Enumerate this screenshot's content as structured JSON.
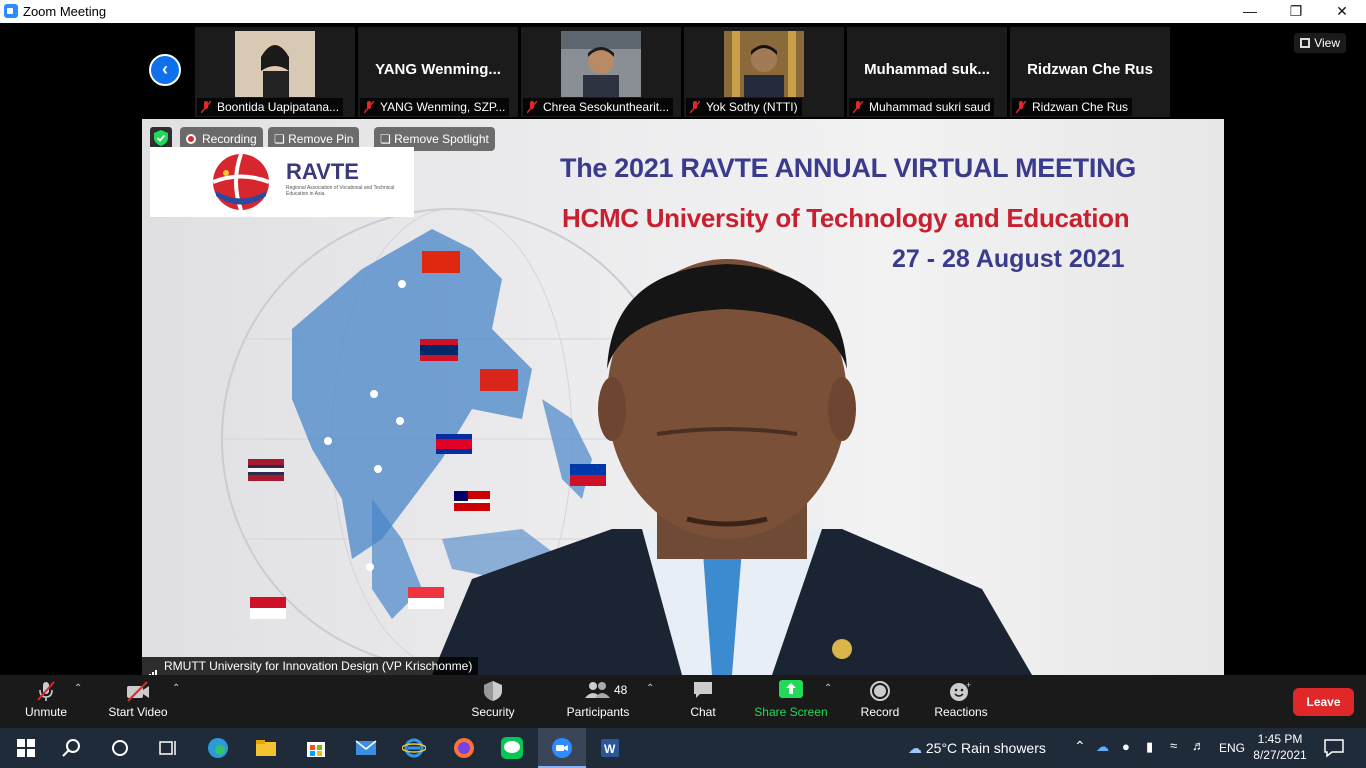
{
  "window": {
    "title": "Zoom Meeting"
  },
  "gallery": {
    "view_label": "View",
    "tiles": [
      {
        "label": "Boontida Uapipatana...",
        "name": ""
      },
      {
        "label": "YANG Wenming, SZP...",
        "name": "YANG  Wenming..."
      },
      {
        "label": "Chrea Sesokunthearit...",
        "name": ""
      },
      {
        "label": "Yok Sothy (NTTI)",
        "name": ""
      },
      {
        "label": "Muhammad sukri saud",
        "name": "Muhammad  suk..."
      },
      {
        "label": "Ridzwan Che Rus",
        "name": "Ridzwan Che Rus"
      }
    ]
  },
  "main": {
    "recording": "Recording",
    "remove_pin": "Remove Pin",
    "remove_spotlight": "Remove Spotlight",
    "logo_text": "RAVTE",
    "logo_sub": "Regional Association of Vocational and Technical Education in Asia",
    "heading": "The 2021 RAVTE ANNUAL VIRTUAL MEETING",
    "subheading": "HCMC University of Technology and Education",
    "dates": "27 - 28 August 2021",
    "speaker_label": "RMUTT University for Innovation Design (VP Krischonme)"
  },
  "toolbar": {
    "unmute": "Unmute",
    "start_video": "Start Video",
    "security": "Security",
    "participants": "Participants",
    "participants_count": "48",
    "chat": "Chat",
    "share_screen": "Share Screen",
    "record": "Record",
    "reactions": "Reactions",
    "leave": "Leave"
  },
  "taskbar": {
    "weather": "25°C  Rain showers",
    "lang": "ENG",
    "time": "1:45 PM",
    "date": "8/27/2021"
  },
  "colors": {
    "zoom_blue": "#0e71eb",
    "leave_red": "#e02828",
    "share_green": "#23d959"
  }
}
